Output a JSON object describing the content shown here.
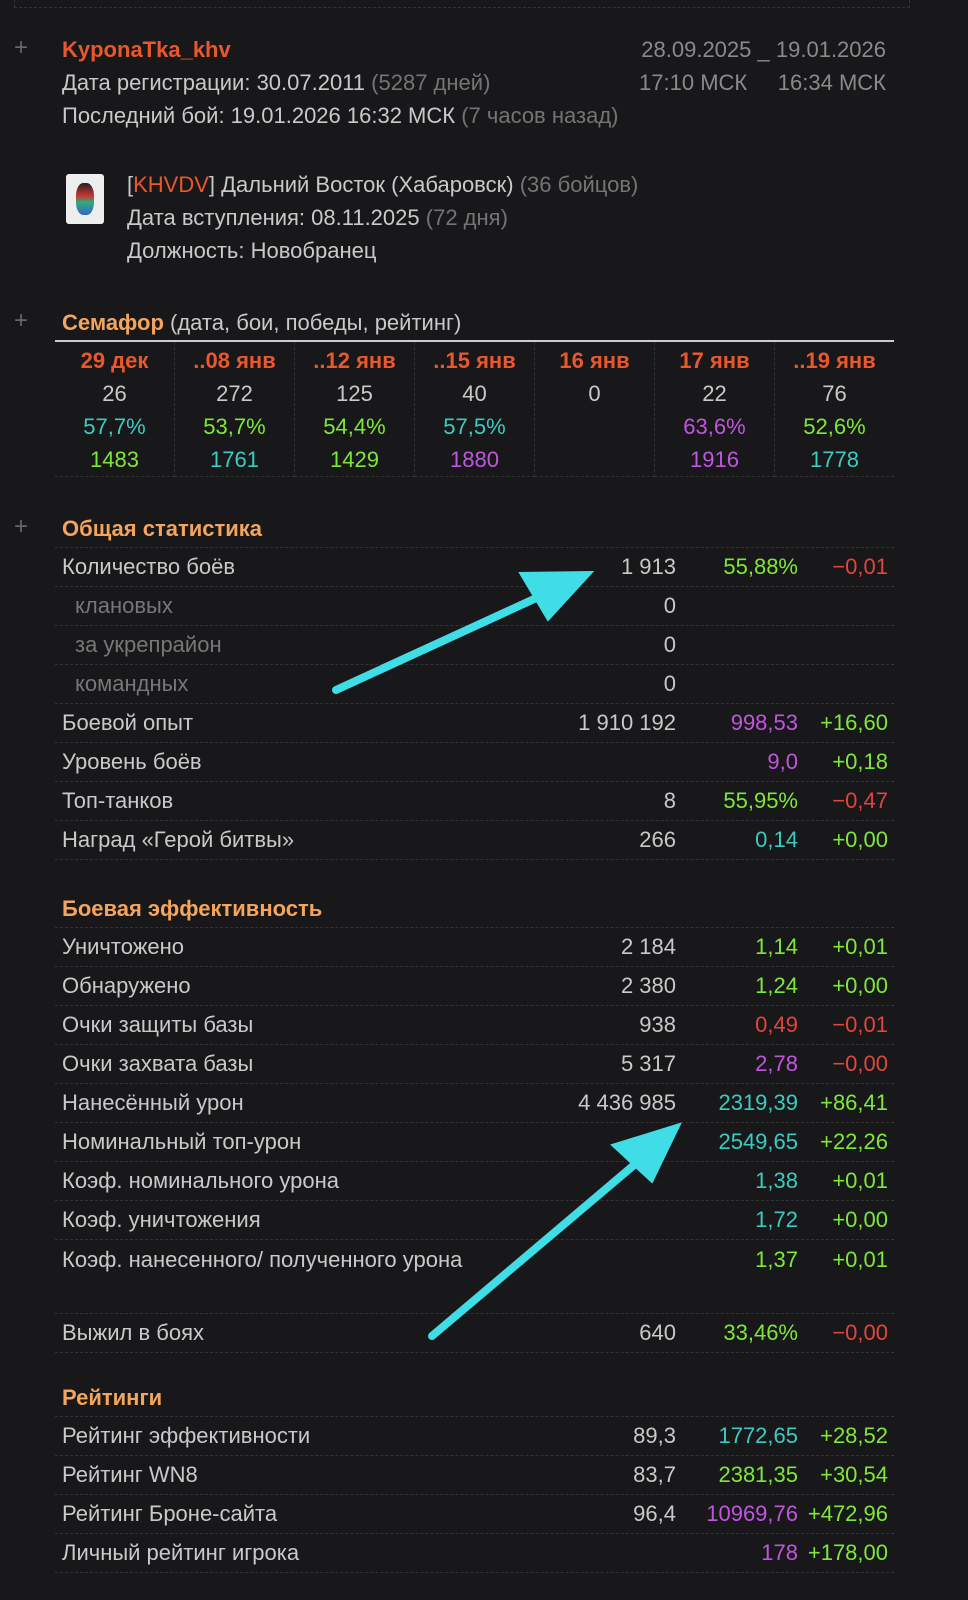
{
  "player": {
    "name": "KyponaTka_khv",
    "reg_label": "Дата регистрации: 30.07.2011",
    "reg_days": "(5287 дней)",
    "last_label": "Последний бой: 19.01.2026 16:32 МСК",
    "last_ago": "(7 часов назад)",
    "range_from_date": "28.09.2025",
    "range_sep": "_",
    "range_to_date": "19.01.2026",
    "range_from_time": "17:10 МСК",
    "range_to_time": "16:34 МСК"
  },
  "clan": {
    "tag": "KHVDV",
    "name": "Дальний Восток (Хабаровск)",
    "members": "(36 бойцов)",
    "join_label": "Дата вступления: 08.11.2025",
    "join_days": "(72 дня)",
    "role": "Должность: Новобранец"
  },
  "semaphore": {
    "title": "Семафор",
    "subtitle": "(дата, бои, победы, рейтинг)",
    "cols": [
      {
        "date": "29 дек",
        "battles": "26",
        "win": "57,7%",
        "wc": "t",
        "rating": "1483",
        "rc": "g"
      },
      {
        "date": "..08 янв",
        "battles": "272",
        "win": "53,7%",
        "wc": "g",
        "rating": "1761",
        "rc": "t"
      },
      {
        "date": "..12 янв",
        "battles": "125",
        "win": "54,4%",
        "wc": "g",
        "rating": "1429",
        "rc": "g"
      },
      {
        "date": "..15 янв",
        "battles": "40",
        "win": "57,5%",
        "wc": "t",
        "rating": "1880",
        "rc": "p"
      },
      {
        "date": "16 янв",
        "battles": "0",
        "win": "",
        "wc": "",
        "rating": "",
        "rc": ""
      },
      {
        "date": "17 янв",
        "battles": "22",
        "win": "63,6%",
        "wc": "p",
        "rating": "1916",
        "rc": "p"
      },
      {
        "date": "..19 янв",
        "battles": "76",
        "win": "52,6%",
        "wc": "g",
        "rating": "1778",
        "rc": "t"
      }
    ]
  },
  "sections": [
    {
      "title": "Общая статистика",
      "rows": [
        {
          "label": "Количество боёв",
          "value": "1 913",
          "pct": "55,88%",
          "pc": "g",
          "delta": "−0,01",
          "dc": "r"
        },
        {
          "label": "клановых",
          "value": "0",
          "sub": true
        },
        {
          "label": "за укрепрайон",
          "value": "0",
          "sub": true
        },
        {
          "label": "командных",
          "value": "0",
          "sub": true
        },
        {
          "label": "Боевой опыт",
          "value": "1 910 192",
          "pct": "998,53",
          "pc": "p",
          "delta": "+16,60",
          "dc": "g"
        },
        {
          "label": "Уровень боёв",
          "value": "",
          "pct": "9,0",
          "pc": "p",
          "delta": "+0,18",
          "dc": "g"
        },
        {
          "label": "Топ-танков",
          "value": "8",
          "pct": "55,95%",
          "pc": "g",
          "delta": "−0,47",
          "dc": "r"
        },
        {
          "label": "Наград «Герой битвы»",
          "value": "266",
          "pct": "0,14",
          "pc": "t",
          "delta": "+0,00",
          "dc": "g"
        }
      ]
    },
    {
      "title": "Боевая эффективность",
      "rows": [
        {
          "label": "Уничтожено",
          "value": "2 184",
          "pct": "1,14",
          "pc": "g",
          "delta": "+0,01",
          "dc": "g"
        },
        {
          "label": "Обнаружено",
          "value": "2 380",
          "pct": "1,24",
          "pc": "g",
          "delta": "+0,00",
          "dc": "g"
        },
        {
          "label": "Очки защиты базы",
          "value": "938",
          "pct": "0,49",
          "pc": "r",
          "delta": "−0,01",
          "dc": "r"
        },
        {
          "label": "Очки захвата базы",
          "value": "5 317",
          "pct": "2,78",
          "pc": "p",
          "delta": "−0,00",
          "dc": "r"
        },
        {
          "label": "Нанесённый урон",
          "value": "4 436 985",
          "pct": "2319,39",
          "pc": "t",
          "delta": "+86,41",
          "dc": "g"
        },
        {
          "label": "Номинальный топ-урон",
          "value": "",
          "pct": "2549,65",
          "pc": "t",
          "delta": "+22,26",
          "dc": "g"
        },
        {
          "label": "Коэф. номинального урона",
          "value": "",
          "pct": "1,38",
          "pc": "t",
          "delta": "+0,01",
          "dc": "g"
        },
        {
          "label": "Коэф. уничтожения",
          "value": "",
          "pct": "1,72",
          "pc": "t",
          "delta": "+0,00",
          "dc": "g"
        },
        {
          "label": "Коэф. нанесенного/ полученного урона",
          "value": "",
          "pct": "1,37",
          "pc": "g",
          "delta": "+0,01",
          "dc": "g",
          "tall": true
        },
        {
          "label": "Выжил в боях",
          "value": "640",
          "pct": "33,46%",
          "pc": "g",
          "delta": "−0,00",
          "dc": "r"
        }
      ]
    },
    {
      "title": "Рейтинги",
      "rows": [
        {
          "label": "Рейтинг эффективности",
          "value": "89,3",
          "pct": "1772,65",
          "pc": "t",
          "delta": "+28,52",
          "dc": "g"
        },
        {
          "label": "Рейтинг WN8",
          "value": "83,7",
          "pct": "2381,35",
          "pc": "g",
          "delta": "+30,54",
          "dc": "g"
        },
        {
          "label": "Рейтинг Броне-сайта",
          "value": "96,4",
          "pct": "10969,76",
          "pc": "p",
          "delta": "+472,96",
          "dc": "g"
        },
        {
          "label": "Личный рейтинг игрока",
          "value": "",
          "pct": "178",
          "pc": "p",
          "delta": "+178,00",
          "dc": "g"
        }
      ]
    }
  ],
  "colors": {
    "accent": "#e8582c",
    "header": "#f4a45c",
    "green": "#7de83a",
    "teal": "#3ccbc0",
    "purple": "#c255e0",
    "red": "#e2453a",
    "arrow": "#3fdde6"
  }
}
